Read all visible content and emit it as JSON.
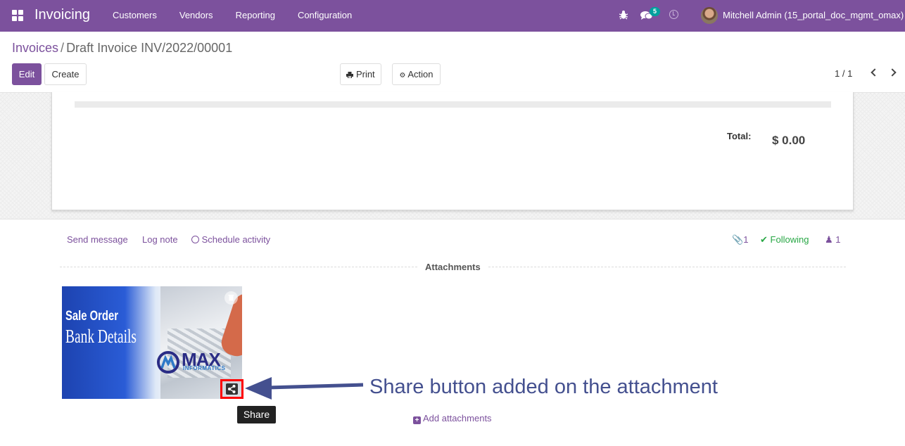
{
  "navbar": {
    "app_name": "Invoicing",
    "menu": [
      "Customers",
      "Vendors",
      "Reporting",
      "Configuration"
    ],
    "messages_count": "5",
    "user": "Mitchell Admin (15_portal_doc_mgmt_omax)",
    "bg_color": "#7c519d"
  },
  "breadcrumb": {
    "parent": "Invoices",
    "separator": "/",
    "current": "Draft Invoice INV/2022/00001"
  },
  "buttons": {
    "edit": "Edit",
    "create": "Create",
    "print": "Print",
    "action": "Action"
  },
  "pager": {
    "value": "1 / 1"
  },
  "invoice": {
    "total_label": "Total:",
    "total_value": "$ 0.00"
  },
  "chatter": {
    "send_message": "Send message",
    "log_note": "Log note",
    "schedule_activity": "Schedule activity",
    "attachment_count": "1",
    "following": "Following",
    "followers_count": "1",
    "attachments_title": "Attachments",
    "add_attachments": "Add attachments"
  },
  "attachment": {
    "image_line1": "Sale Order",
    "image_line2": "Bank Details",
    "logo_text": "MAX",
    "logo_sub": "INFORMATICS",
    "tooltip": "Share"
  },
  "annotation": {
    "text": "Share button added on the attachment",
    "arrow_color": "#44508f",
    "highlight_color": "#ff0000"
  }
}
